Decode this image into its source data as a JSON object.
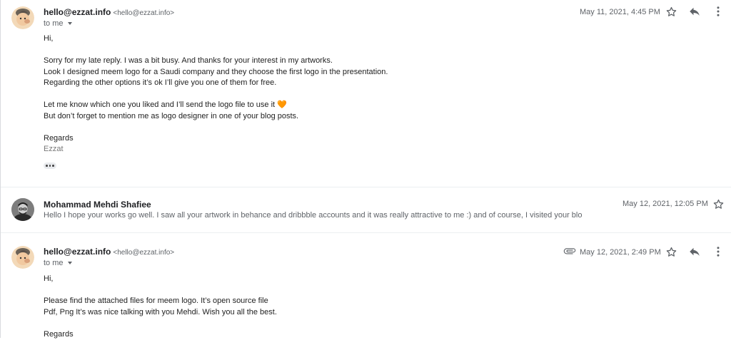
{
  "messages": [
    {
      "sender_name": "hello@ezzat.info",
      "sender_email": "<hello@ezzat.info>",
      "recipient": "to me",
      "date": "May 11, 2021, 4:45 PM",
      "body": [
        "Hi,",
        "",
        "Sorry for my late reply. I was a bit busy. And thanks for your interest in my artworks.",
        "Look I designed meem logo for a Saudi company and they choose the first logo in the presentation.",
        "Regarding the other options it’s ok I’ll give you one of them for free.",
        "",
        "Let me know which one you liked and I’ll send the logo file to use it 🧡",
        "But don’t forget to mention me as logo designer in one of your blog posts.",
        "",
        "Regards"
      ],
      "signature": "Ezzat"
    },
    {
      "sender_name": "Mohammad Mehdi Shafiee",
      "date": "May 12, 2021, 12:05 PM",
      "snippet": "Hello I hope your works go well. I saw all your artwork in behance and dribbble accounts and it was really attractive to me :) and of course, I visited your blo"
    },
    {
      "sender_name": "hello@ezzat.info",
      "sender_email": "<hello@ezzat.info>",
      "recipient": "to me",
      "date": "May 12, 2021, 2:49 PM",
      "has_attachment": true,
      "body": [
        "Hi,",
        "",
        "Please find the attached files for meem logo. It’s open source file",
        "Pdf, Png It’s was nice talking with you Mehdi. Wish you all the best.",
        "",
        "Regards"
      ]
    }
  ],
  "icons": {
    "star": "star-icon",
    "reply": "reply-icon",
    "more": "more-vert-icon",
    "attachment": "paperclip-icon"
  },
  "colors": {
    "text": "#202124",
    "muted": "#5f6368",
    "icon": "#5f6368"
  }
}
